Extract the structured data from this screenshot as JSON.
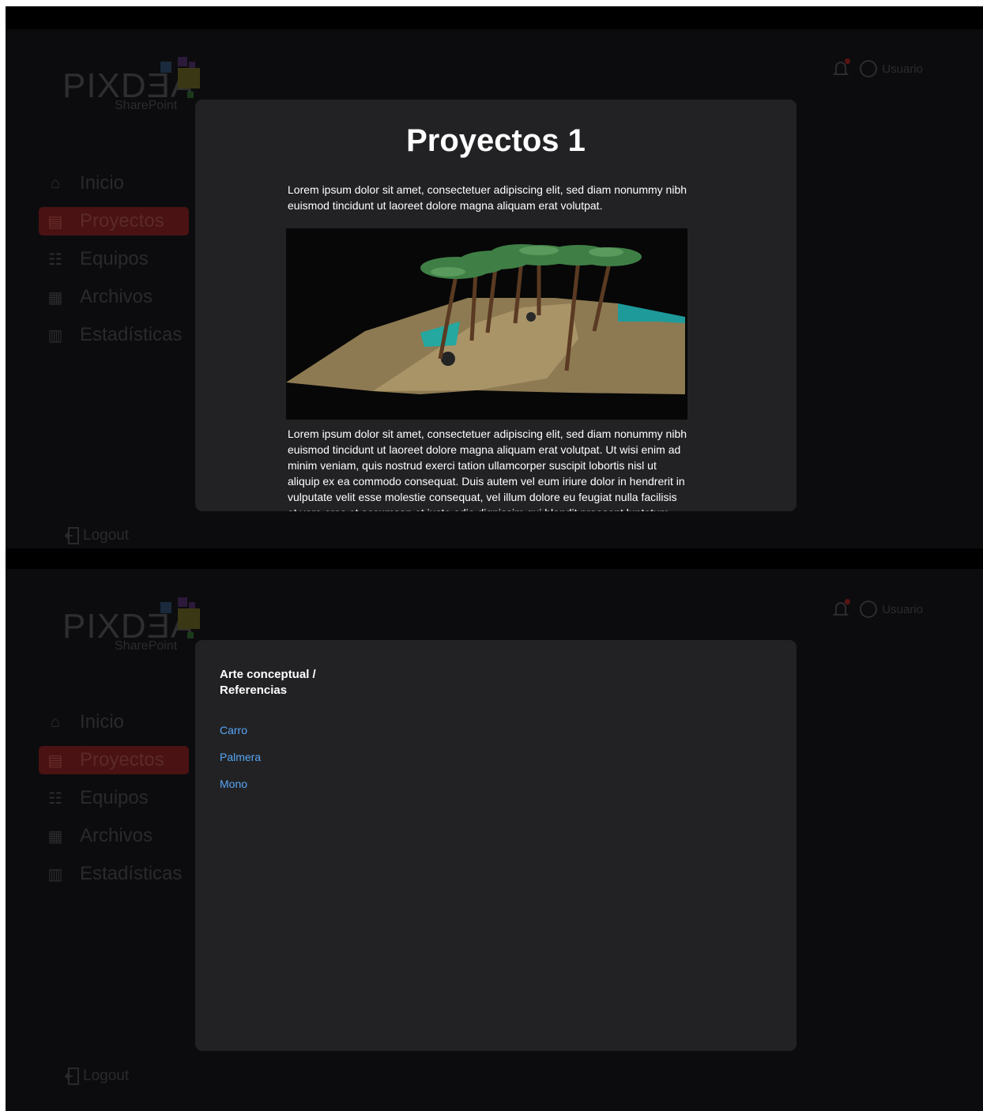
{
  "brand": {
    "name": "PIXDƎA",
    "sub": "SharePoint"
  },
  "nav": {
    "items": [
      {
        "label": "Inicio",
        "icon": "home-icon"
      },
      {
        "label": "Proyectos",
        "icon": "projects-icon",
        "active": true
      },
      {
        "label": "Equipos",
        "icon": "team-icon"
      },
      {
        "label": "Archivos",
        "icon": "files-icon"
      },
      {
        "label": "Estadísticas",
        "icon": "stats-icon"
      }
    ]
  },
  "logout_label": "Logout",
  "user_label": "Usuario",
  "colors": {
    "accent": "#4a1212",
    "link": "#58a6f3",
    "modal_bg": "#222225"
  },
  "project_modal": {
    "title": "Proyectos 1",
    "intro": "Lorem ipsum dolor sit amet, consectetuer adipiscing elit, sed diam nonummy nibh euismod tincidunt ut laoreet dolore magna aliquam erat volutpat.",
    "body": "Lorem ipsum dolor sit amet, consectetuer adipiscing elit, sed diam nonummy nibh euismod tincidunt ut laoreet dolore magna aliquam erat volutpat. Ut wisi enim ad minim veniam, quis nostrud exerci tation ullamcorper suscipit lobortis nisl ut aliquip ex ea commodo consequat. Duis autem vel eum iriure dolor in hendrerit in vulputate velit esse molestie consequat, vel illum dolore eu feugiat nulla facilisis at vero eros et accumsan et iusto odio dignissim qui blandit praesent luptatum"
  },
  "reference_modal": {
    "title": "Arte conceptual / Referencias",
    "links": [
      "Carro",
      "Palmera",
      "Mono"
    ]
  }
}
